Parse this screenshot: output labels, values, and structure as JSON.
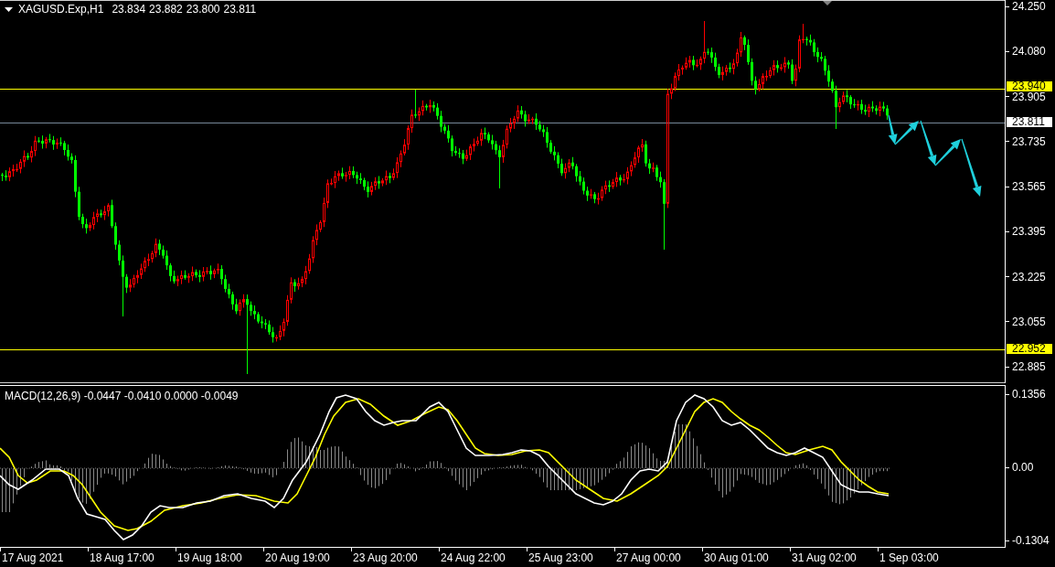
{
  "header": {
    "symbol": "XAGUSD.Exp,H1",
    "ohlc": [
      "23.834",
      "23.882",
      "23.800",
      "23.811"
    ]
  },
  "price_axis": {
    "ticks": [
      "24.250",
      "24.080",
      "23.905",
      "23.735",
      "23.565",
      "23.395",
      "23.225",
      "23.055",
      "22.885"
    ]
  },
  "price_lines": [
    {
      "kind": "level",
      "label": "23.940",
      "color": "#ffff00"
    },
    {
      "kind": "bid",
      "label": "23.811",
      "color": "#ffffff"
    },
    {
      "kind": "level",
      "label": "22.952",
      "color": "#ffff00"
    }
  ],
  "indicator": {
    "label": "MACD(12,26,9) -0.0447 -0.0410 0.0000 -0.0049",
    "ticks": [
      "0.1356",
      "0.00",
      "-0.1304"
    ]
  },
  "time_axis": {
    "labels": [
      "17 Aug 2021",
      "18 Aug 17:00",
      "19 Aug 18:00",
      "20 Aug 19:00",
      "23 Aug 20:00",
      "24 Aug 22:00",
      "25 Aug 23:00",
      "27 Aug 00:00",
      "30 Aug 01:00",
      "31 Aug 02:00",
      "1 Sep 03:00"
    ]
  }
}
